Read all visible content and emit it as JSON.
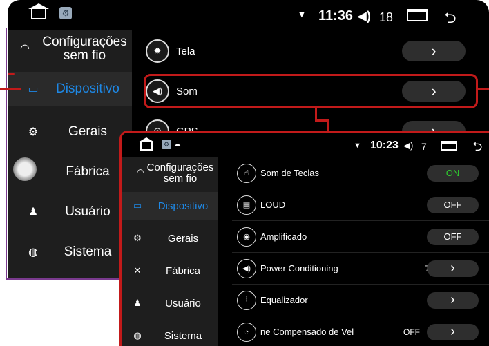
{
  "back": {
    "status": {
      "time": "11:36",
      "volume_level": "18"
    },
    "sidebar": {
      "wifi_label": "Configurações\nsem fio",
      "items": [
        {
          "label": "Dispositivo",
          "icon": "monitor-icon",
          "active": true
        },
        {
          "label": "Gerais",
          "icon": "gear-icon"
        },
        {
          "label": "Fábrica",
          "icon": "tools-icon"
        },
        {
          "label": "Usuário",
          "icon": "user-icon"
        },
        {
          "label": "Sistema",
          "icon": "globe-icon"
        }
      ]
    },
    "rows": [
      {
        "label": "Tela",
        "icon": "brightness-icon"
      },
      {
        "label": "Som",
        "icon": "speaker-icon",
        "highlighted": true
      },
      {
        "label": "GPS",
        "icon": "gps-icon"
      }
    ]
  },
  "front": {
    "status": {
      "time": "10:23",
      "volume_level": "7"
    },
    "sidebar": {
      "wifi_label": "Configurações\nsem fio",
      "items": [
        {
          "label": "Dispositivo",
          "icon": "monitor-icon",
          "active": true
        },
        {
          "label": "Gerais",
          "icon": "gear-icon"
        },
        {
          "label": "Fábrica",
          "icon": "tools-icon"
        },
        {
          "label": "Usuário",
          "icon": "user-icon"
        },
        {
          "label": "Sistema",
          "icon": "globe-icon"
        }
      ]
    },
    "rows": [
      {
        "label": "Som de Teclas",
        "icon": "touch-icon",
        "value": "ON"
      },
      {
        "label": "LOUD",
        "icon": "drum-icon",
        "value": "OFF"
      },
      {
        "label": "Amplificado",
        "icon": "amp-icon",
        "value": "OFF"
      },
      {
        "label": "Power Conditioning",
        "icon": "speaker-icon",
        "value": "7",
        "arrow": "›"
      },
      {
        "label": "Equalizador",
        "icon": "equalizer-icon",
        "arrow": "›"
      },
      {
        "label": "ne Compensado de Vel",
        "icon": "speedometer-icon",
        "value": "OFF",
        "arrow": "›"
      }
    ]
  },
  "colors": {
    "active": "#1e88e5",
    "on": "#2fcf2f",
    "highlight": "#c21a1a",
    "frame": "#7a3a8e"
  }
}
